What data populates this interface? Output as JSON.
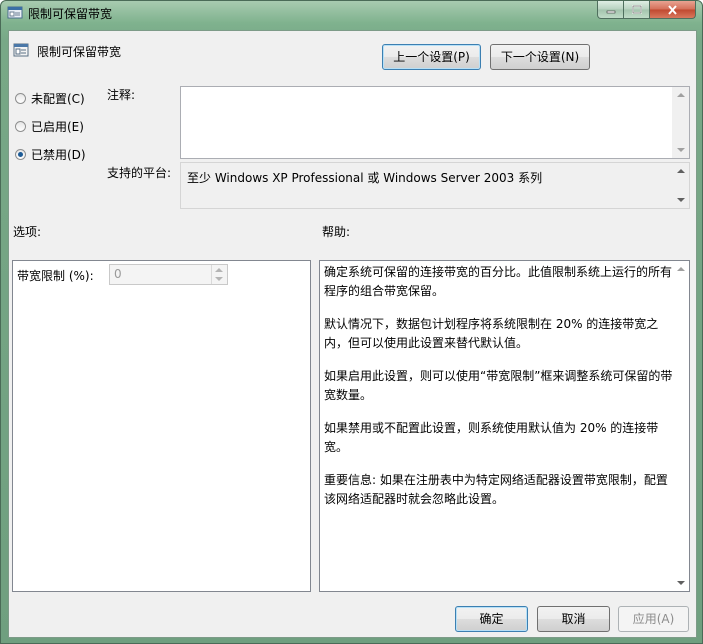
{
  "window": {
    "title": "限制可保留带宽",
    "icon": "policy-icon",
    "caption_buttons": [
      "minimize-icon",
      "maximize-icon",
      "close-icon"
    ]
  },
  "header": {
    "setting_name": "限制可保留带宽",
    "prev_button": "上一个设置(P)",
    "next_button": "下一个设置(N)"
  },
  "state": {
    "options": [
      {
        "label": "未配置(C)",
        "checked": false
      },
      {
        "label": "已启用(E)",
        "checked": false
      },
      {
        "label": "已禁用(D)",
        "checked": true
      }
    ]
  },
  "comment": {
    "label": "注释:",
    "value": ""
  },
  "platform": {
    "label": "支持的平台:",
    "value": "至少 Windows XP Professional 或 Windows Server 2003 系列"
  },
  "options_section": {
    "label": "选项:",
    "bandwidth_label": "带宽限制 (%):",
    "bandwidth_value": "0"
  },
  "help_section": {
    "label": "帮助:",
    "paragraphs": [
      "确定系统可保留的连接带宽的百分比。此值限制系统上运行的所有程序的组合带宽保留。",
      "默认情况下，数据包计划程序将系统限制在 20% 的连接带宽之内，但可以使用此设置来替代默认值。",
      "如果启用此设置，则可以使用“带宽限制”框来调整系统可保留的带宽数量。",
      "如果禁用或不配置此设置，则系统使用默认值为 20% 的连接带宽。",
      "重要信息: 如果在注册表中为特定网络适配器设置带宽限制，配置该网络适配器时就会忽略此设置。"
    ]
  },
  "footer": {
    "ok": "确定",
    "cancel": "取消",
    "apply": "应用(A)"
  }
}
